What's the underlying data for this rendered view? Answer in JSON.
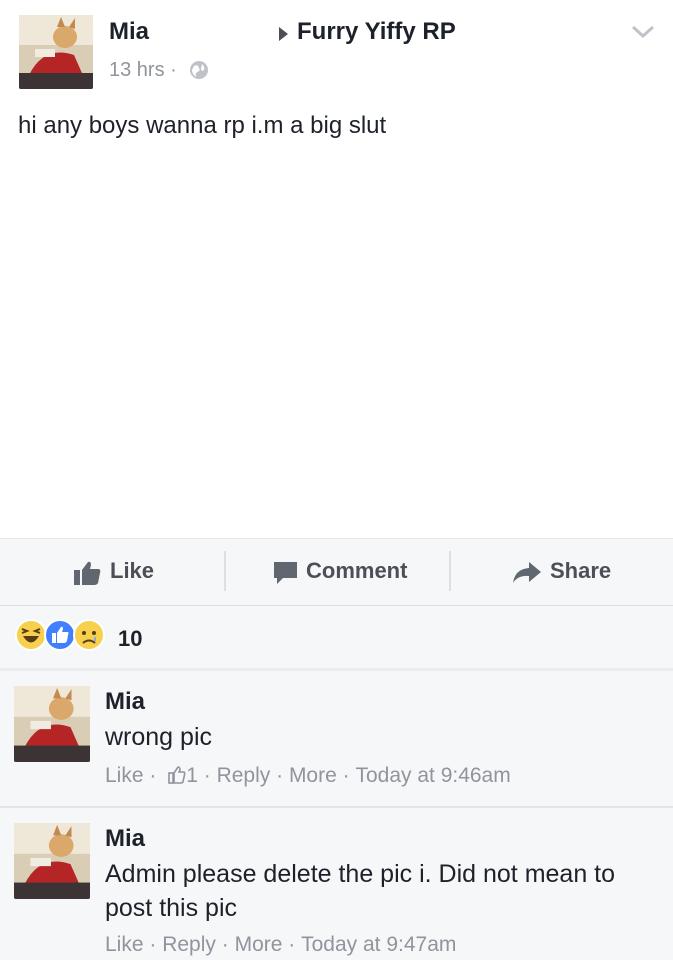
{
  "post": {
    "author": "Mia",
    "group": "Furry Yiffy RP",
    "time": "13 hrs",
    "dot": "·",
    "text": "hi any boys wanna rp i.m a big slut"
  },
  "actions": {
    "like": "Like",
    "comment": "Comment",
    "share": "Share"
  },
  "reactions": {
    "count": "10",
    "icons": [
      "haha-icon",
      "like-reaction-icon",
      "sad-icon"
    ]
  },
  "comments": [
    {
      "author": "Mia",
      "text": "wrong pic",
      "like": "Like",
      "like_count": "1",
      "reply": "Reply",
      "more": "More",
      "time": "Today at 9:46am"
    },
    {
      "author": "Mia",
      "text": "Admin please delete the pic i. Did not mean to post this pic",
      "like": "Like",
      "reply": "Reply",
      "more": "More",
      "time": "Today at 9:47am"
    }
  ],
  "colors": {
    "text": "#1d2129",
    "meta": "#90949c",
    "action": "#4b4f56",
    "panel": "#f6f7f9",
    "like_blue": "#4080ff",
    "haha_yellow": "#f7d04e"
  }
}
